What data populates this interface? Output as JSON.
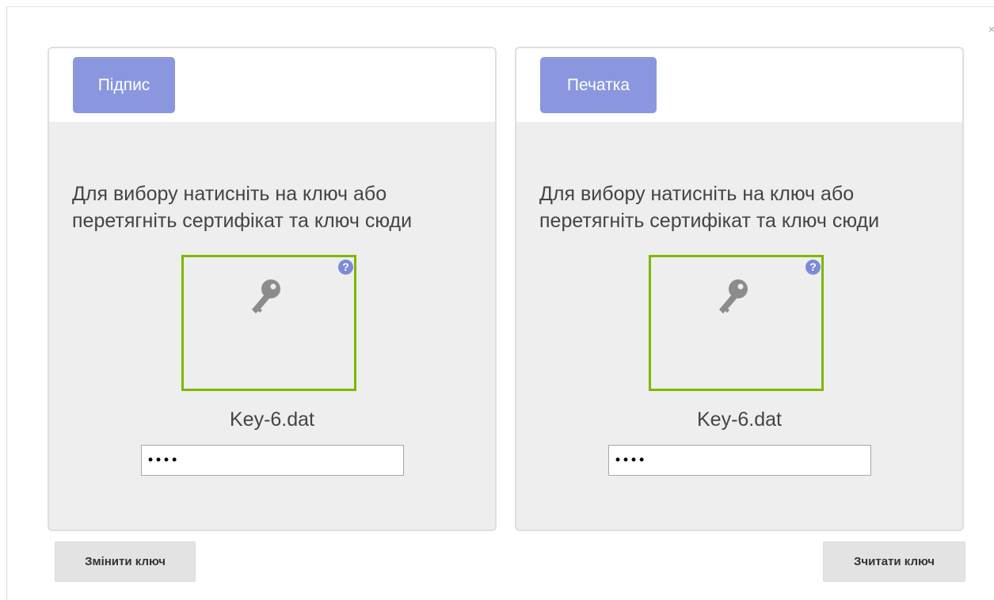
{
  "dialog": {
    "close_label": "×"
  },
  "panels": [
    {
      "tab_label": "Підпис",
      "instruction": "Для вибору натисніть на ключ або перетягніть сертифікат та ключ сюди",
      "file_name": "Key-6.dat",
      "password_value": "••••",
      "key_icon": "key-icon",
      "help_icon_label": "?"
    },
    {
      "tab_label": "Печатка",
      "instruction": "Для вибору натисніть на ключ або перетягніть сертифікат та ключ сюди",
      "file_name": "Key-6.dat",
      "password_value": "••••",
      "key_icon": "key-icon",
      "help_icon_label": "?"
    }
  ],
  "buttons": {
    "change_key": "Змінити ключ",
    "read_key": "Зчитати ключ"
  },
  "colors": {
    "tab_bg": "#8a97de",
    "key_box_border": "#7cb800",
    "help_icon_bg": "#7d8ad6",
    "panel_bg": "#eeeeee"
  }
}
